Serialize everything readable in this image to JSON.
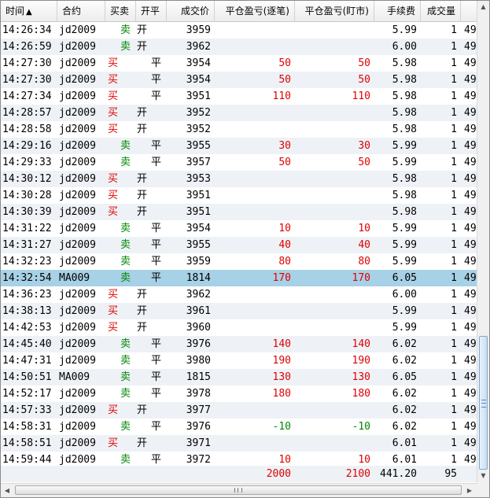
{
  "columns": {
    "time": "时间",
    "sort_indicator": "▲",
    "contract": "合约",
    "side": "买卖",
    "open_close": "开平",
    "price": "成交价",
    "pnl_each": "平仓盈亏(逐笔)",
    "pnl_mark": "平仓盈亏(盯市)",
    "fee": "手续费",
    "volume": "成交量"
  },
  "rows": [
    {
      "time": "14:26:34",
      "contract": "jd2009",
      "side": "卖",
      "oc": "开",
      "price": "3959",
      "pnl1": "",
      "pnl2": "",
      "fee": "5.99",
      "vol": "1",
      "tail": "49"
    },
    {
      "time": "14:26:59",
      "contract": "jd2009",
      "side": "卖",
      "oc": "开",
      "price": "3962",
      "pnl1": "",
      "pnl2": "",
      "fee": "6.00",
      "vol": "1",
      "tail": "49"
    },
    {
      "time": "14:27:30",
      "contract": "jd2009",
      "side": "买",
      "oc": "平",
      "price": "3954",
      "pnl1": "50",
      "pnl2": "50",
      "fee": "5.98",
      "vol": "1",
      "tail": "49"
    },
    {
      "time": "14:27:30",
      "contract": "jd2009",
      "side": "买",
      "oc": "平",
      "price": "3954",
      "pnl1": "50",
      "pnl2": "50",
      "fee": "5.98",
      "vol": "1",
      "tail": "49"
    },
    {
      "time": "14:27:34",
      "contract": "jd2009",
      "side": "买",
      "oc": "平",
      "price": "3951",
      "pnl1": "110",
      "pnl2": "110",
      "fee": "5.98",
      "vol": "1",
      "tail": "49"
    },
    {
      "time": "14:28:57",
      "contract": "jd2009",
      "side": "买",
      "oc": "开",
      "price": "3952",
      "pnl1": "",
      "pnl2": "",
      "fee": "5.98",
      "vol": "1",
      "tail": "49"
    },
    {
      "time": "14:28:58",
      "contract": "jd2009",
      "side": "买",
      "oc": "开",
      "price": "3952",
      "pnl1": "",
      "pnl2": "",
      "fee": "5.98",
      "vol": "1",
      "tail": "49"
    },
    {
      "time": "14:29:16",
      "contract": "jd2009",
      "side": "卖",
      "oc": "平",
      "price": "3955",
      "pnl1": "30",
      "pnl2": "30",
      "fee": "5.99",
      "vol": "1",
      "tail": "49"
    },
    {
      "time": "14:29:33",
      "contract": "jd2009",
      "side": "卖",
      "oc": "平",
      "price": "3957",
      "pnl1": "50",
      "pnl2": "50",
      "fee": "5.99",
      "vol": "1",
      "tail": "49"
    },
    {
      "time": "14:30:12",
      "contract": "jd2009",
      "side": "买",
      "oc": "开",
      "price": "3953",
      "pnl1": "",
      "pnl2": "",
      "fee": "5.98",
      "vol": "1",
      "tail": "49"
    },
    {
      "time": "14:30:28",
      "contract": "jd2009",
      "side": "买",
      "oc": "开",
      "price": "3951",
      "pnl1": "",
      "pnl2": "",
      "fee": "5.98",
      "vol": "1",
      "tail": "49"
    },
    {
      "time": "14:30:39",
      "contract": "jd2009",
      "side": "买",
      "oc": "开",
      "price": "3951",
      "pnl1": "",
      "pnl2": "",
      "fee": "5.98",
      "vol": "1",
      "tail": "49"
    },
    {
      "time": "14:31:22",
      "contract": "jd2009",
      "side": "卖",
      "oc": "平",
      "price": "3954",
      "pnl1": "10",
      "pnl2": "10",
      "fee": "5.99",
      "vol": "1",
      "tail": "49"
    },
    {
      "time": "14:31:27",
      "contract": "jd2009",
      "side": "卖",
      "oc": "平",
      "price": "3955",
      "pnl1": "40",
      "pnl2": "40",
      "fee": "5.99",
      "vol": "1",
      "tail": "49"
    },
    {
      "time": "14:32:23",
      "contract": "jd2009",
      "side": "卖",
      "oc": "平",
      "price": "3959",
      "pnl1": "80",
      "pnl2": "80",
      "fee": "5.99",
      "vol": "1",
      "tail": "49"
    },
    {
      "time": "14:32:54",
      "contract": "MA009",
      "side": "卖",
      "oc": "平",
      "price": "1814",
      "pnl1": "170",
      "pnl2": "170",
      "fee": "6.05",
      "vol": "1",
      "tail": "49",
      "selected": true
    },
    {
      "time": "14:36:23",
      "contract": "jd2009",
      "side": "买",
      "oc": "开",
      "price": "3962",
      "pnl1": "",
      "pnl2": "",
      "fee": "6.00",
      "vol": "1",
      "tail": "49"
    },
    {
      "time": "14:38:13",
      "contract": "jd2009",
      "side": "买",
      "oc": "开",
      "price": "3961",
      "pnl1": "",
      "pnl2": "",
      "fee": "5.99",
      "vol": "1",
      "tail": "49"
    },
    {
      "time": "14:42:53",
      "contract": "jd2009",
      "side": "买",
      "oc": "开",
      "price": "3960",
      "pnl1": "",
      "pnl2": "",
      "fee": "5.99",
      "vol": "1",
      "tail": "49"
    },
    {
      "time": "14:45:40",
      "contract": "jd2009",
      "side": "卖",
      "oc": "平",
      "price": "3976",
      "pnl1": "140",
      "pnl2": "140",
      "fee": "6.02",
      "vol": "1",
      "tail": "49"
    },
    {
      "time": "14:47:31",
      "contract": "jd2009",
      "side": "卖",
      "oc": "平",
      "price": "3980",
      "pnl1": "190",
      "pnl2": "190",
      "fee": "6.02",
      "vol": "1",
      "tail": "49"
    },
    {
      "time": "14:50:51",
      "contract": "MA009",
      "side": "卖",
      "oc": "平",
      "price": "1815",
      "pnl1": "130",
      "pnl2": "130",
      "fee": "6.05",
      "vol": "1",
      "tail": "49"
    },
    {
      "time": "14:52:17",
      "contract": "jd2009",
      "side": "卖",
      "oc": "平",
      "price": "3978",
      "pnl1": "180",
      "pnl2": "180",
      "fee": "6.02",
      "vol": "1",
      "tail": "49"
    },
    {
      "time": "14:57:33",
      "contract": "jd2009",
      "side": "买",
      "oc": "开",
      "price": "3977",
      "pnl1": "",
      "pnl2": "",
      "fee": "6.02",
      "vol": "1",
      "tail": "49"
    },
    {
      "time": "14:58:31",
      "contract": "jd2009",
      "side": "卖",
      "oc": "平",
      "price": "3976",
      "pnl1": "-10",
      "pnl2": "-10",
      "fee": "6.02",
      "vol": "1",
      "tail": "49"
    },
    {
      "time": "14:58:51",
      "contract": "jd2009",
      "side": "买",
      "oc": "开",
      "price": "3971",
      "pnl1": "",
      "pnl2": "",
      "fee": "6.01",
      "vol": "1",
      "tail": "49"
    },
    {
      "time": "14:59:44",
      "contract": "jd2009",
      "side": "卖",
      "oc": "平",
      "price": "3972",
      "pnl1": "10",
      "pnl2": "10",
      "fee": "6.01",
      "vol": "1",
      "tail": "49"
    }
  ],
  "summary": {
    "pnl1": "2000",
    "pnl2": "2100",
    "fee": "441.20",
    "vol": "95"
  },
  "scrollbar": {
    "up": "▲",
    "down": "▼",
    "left": "◀",
    "right": "▶"
  },
  "colors": {
    "buy": "#e00000",
    "sell": "#008800",
    "selected_row": "#a7d1e6",
    "alt_row": "#eef2f6"
  }
}
